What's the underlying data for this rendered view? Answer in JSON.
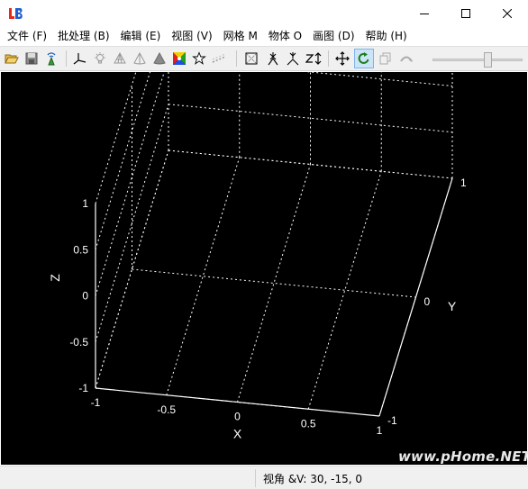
{
  "window": {
    "logo": "LB",
    "controls": {
      "minimize": "minimize-icon",
      "maximize": "maximize-icon",
      "close": "close-icon"
    }
  },
  "menu": [
    "文件 (F)",
    "批处理 (B)",
    "编辑 (E)",
    "视图 (V)",
    "网格 M",
    "物体 O",
    "画图 (D)",
    "帮助 (H)"
  ],
  "toolbar": {
    "icons": [
      "open-folder-icon",
      "save-icon",
      "antenna-icon",
      "axes-icon",
      "light-icon",
      "wireframe-cone-icon",
      "outline-cone-icon",
      "solid-cone-icon",
      "colormap-icon",
      "star-icon",
      "dashed-line-icon",
      "box-icon",
      "x-axis-icon",
      "y-axis-icon",
      "z-axis-icon",
      "pan-icon",
      "rotate-icon",
      "copy-icon",
      "undo-icon"
    ],
    "active": "rotate-icon",
    "slider_level": 0.64
  },
  "chart_data": {
    "type": "3d-axes",
    "xlabel": "X",
    "ylabel": "Y",
    "zlabel": "Z",
    "xlim": [
      -1,
      1
    ],
    "ylim": [
      -1,
      1
    ],
    "zlim": [
      -1,
      1
    ],
    "x_ticks": [
      "-1",
      "-0.5",
      "0",
      "0.5",
      "1"
    ],
    "y_ticks": [
      "-1",
      "0",
      "1"
    ],
    "z_ticks": [
      "-1",
      "-0.5",
      "0",
      "0.5",
      "1"
    ],
    "grid": true,
    "background": "#000000",
    "foreground": "#ffffff",
    "view": {
      "azimuth": 30,
      "elevation": -15
    }
  },
  "status": {
    "view_text": "视角 &V: 30, -15, 0"
  },
  "watermark": "www.pHome.NET"
}
